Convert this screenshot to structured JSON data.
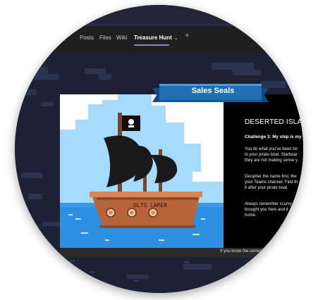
{
  "tabs": [
    {
      "label": "Posts"
    },
    {
      "label": "Files"
    },
    {
      "label": "Wiki"
    },
    {
      "label": "Treasure Hunt",
      "active": true
    }
  ],
  "add_tab_icon": "plus-icon",
  "dropdown_icon": "chevron-down-icon",
  "banner": {
    "title": "Sales Seals"
  },
  "ship": {
    "name": "OLTS LAPER"
  },
  "story": {
    "title": "DESERTED ISLAND",
    "subtitle": "Challenge 3: My ship is my",
    "p1": [
      "You do what you've been tol",
      "to your pirate boat. Starboar",
      "they are not making sense y"
    ],
    "p2": [
      "Decipher the name first, the",
      "your Teams channel. Find th",
      "it after your pirate boat."
    ],
    "p3": [
      "Always remember scurvy",
      "brought you here and it",
      "home."
    ]
  },
  "footer": {
    "text": "If you know the correct"
  },
  "colors": {
    "tab_accent": "#8b8cc7",
    "banner_blue": "#1f6fb5",
    "sky": "#a6dbff",
    "sea": "#2d8fe0",
    "hull": "#b7643a"
  }
}
